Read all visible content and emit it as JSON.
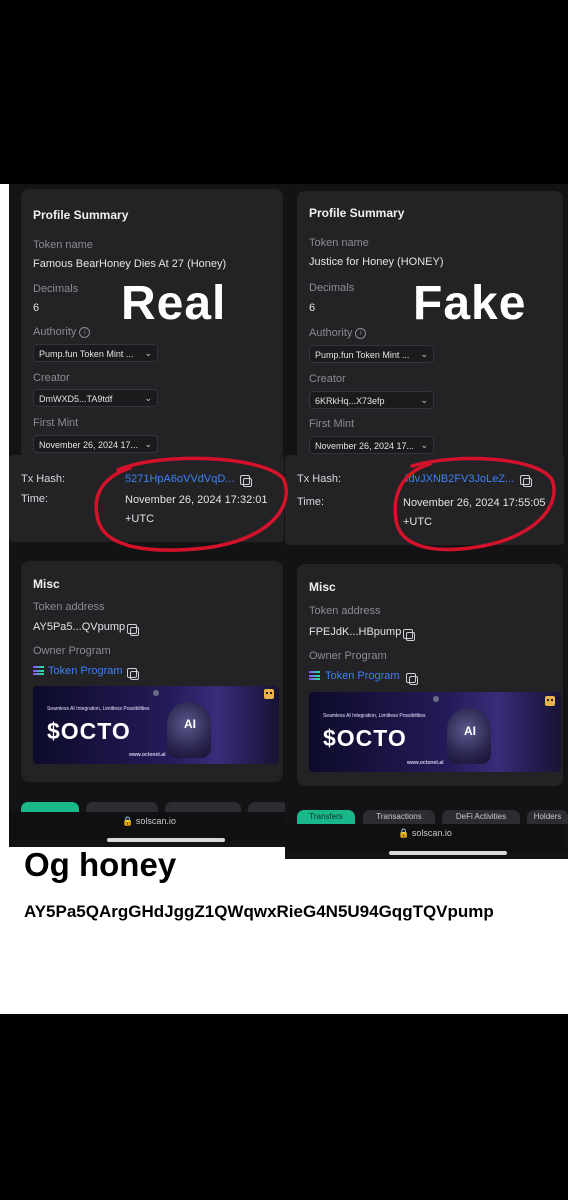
{
  "left": {
    "overlay": "Real",
    "profile": {
      "title": "Profile Summary",
      "token_name_label": "Token name",
      "token_name": "Famous BearHoney Dies At 27 (Honey)",
      "decimals_label": "Decimals",
      "decimals": "6",
      "authority_label": "Authority",
      "authority": "Pump.fun Token Mint ...",
      "creator_label": "Creator",
      "creator": "DmWXD5...TA9tdf",
      "first_mint_label": "First Mint",
      "first_mint": "November 26, 2024 17..."
    },
    "tx": {
      "hash_label": "Tx Hash:",
      "hash": "5271HpA6oVVdVqD...",
      "time_label": "Time:",
      "time": "November 26, 2024 17:32:01 +UTC"
    },
    "misc": {
      "title": "Misc",
      "token_address_label": "Token address",
      "token_address": "AY5Pa5...QVpump",
      "owner_program_label": "Owner Program",
      "owner_program": "Token Program"
    },
    "banner": {
      "tagline": "Seamless AI Integration, Limitless Possibilities",
      "title": "$OCTO",
      "url": "www.octonet.ai",
      "badge": "AI"
    },
    "url_bar": "solscan.io"
  },
  "right": {
    "overlay": "Fake",
    "profile": {
      "title": "Profile Summary",
      "token_name_label": "Token name",
      "token_name": "Justice for Honey (HONEY)",
      "decimals_label": "Decimals",
      "decimals": "6",
      "authority_label": "Authority",
      "authority": "Pump.fun Token Mint ...",
      "creator_label": "Creator",
      "creator": "6KRkHq...X73efp",
      "first_mint_label": "First Mint",
      "first_mint": "November 26, 2024 17..."
    },
    "tx": {
      "hash_label": "Tx Hash:",
      "hash": "JdvJXNB2FV3JoLeZ...",
      "time_label": "Time:",
      "time": "November 26, 2024 17:55:05 +UTC"
    },
    "misc": {
      "title": "Misc",
      "token_address_label": "Token address",
      "token_address": "FPEJdK...HBpump",
      "owner_program_label": "Owner Program",
      "owner_program": "Token Program"
    },
    "banner": {
      "tagline": "Seamless AI Integration, Limitless Possibilities",
      "title": "$OCTO",
      "url": "www.octonet.ai",
      "badge": "AI"
    },
    "tabs": [
      "Transfers",
      "Transactions",
      "DeFi Activities",
      "Holders"
    ],
    "url_bar": "solscan.io"
  },
  "caption": {
    "title": "Og honey",
    "address": "AY5Pa5QArgGHdJggZ1QWqwxRieG4N5U94GqgTQVpump"
  },
  "colors": {
    "annotation_red": "#d5122b",
    "link_blue": "#3b82f6",
    "accent_green": "#18b88a"
  }
}
